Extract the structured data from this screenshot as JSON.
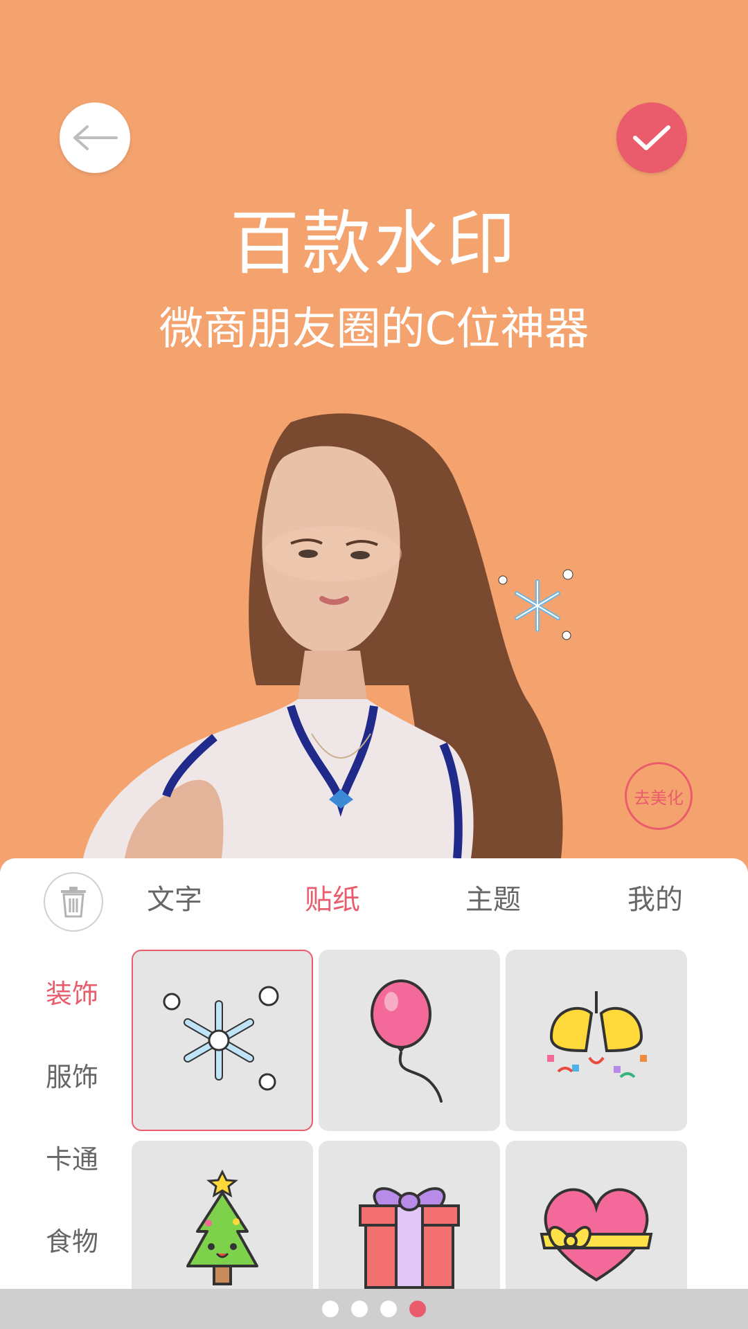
{
  "header": {
    "headline": "百款水印",
    "subline": "微商朋友圈的C位神器"
  },
  "photo": {
    "subject": "woman-portrait"
  },
  "overlay": {
    "beauty_label": "去美化"
  },
  "panel": {
    "tabs": [
      {
        "label": "文字"
      },
      {
        "label": "贴纸"
      },
      {
        "label": "主题"
      },
      {
        "label": "我的"
      }
    ],
    "active_tab": "贴纸",
    "categories": [
      {
        "label": "装饰"
      },
      {
        "label": "服饰"
      },
      {
        "label": "卡通"
      },
      {
        "label": "食物"
      }
    ],
    "active_category": "装饰",
    "stickers": [
      {
        "icon": "snowflake-icon"
      },
      {
        "icon": "balloon-icon"
      },
      {
        "icon": "party-bells-icon"
      },
      {
        "icon": "christmas-tree-icon"
      },
      {
        "icon": "gift-box-icon"
      },
      {
        "icon": "heart-ribbon-icon"
      }
    ]
  },
  "pager": {
    "count": 4,
    "active_index": 3
  },
  "colors": {
    "background": "#f4a36f",
    "accent": "#ea5c6c",
    "tab_inactive": "#666666",
    "cell_bg": "#e5e5e5"
  }
}
